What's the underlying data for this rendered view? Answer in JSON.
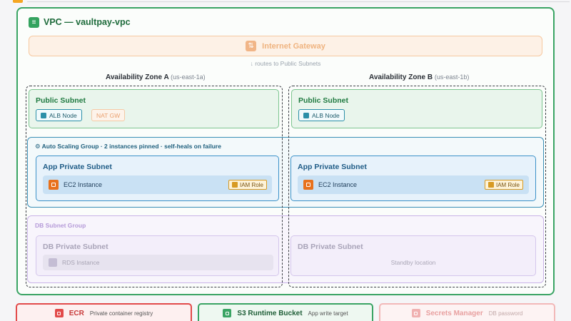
{
  "vpc": {
    "title": "VPC — vaultpay-vpc",
    "icon": "list-icon",
    "color": "#3aa464"
  },
  "gateway": {
    "label": "Internet Gateway",
    "icon": "transfer-icon",
    "note": "↓ routes to Public Subnets"
  },
  "zones": [
    {
      "name": "Availability Zone A",
      "region": "(us-east-1a)"
    },
    {
      "name": "Availability Zone B",
      "region": "(us-east-1b)"
    }
  ],
  "public_subnets": [
    {
      "title": "Public Subnet",
      "alb": "ALB Node",
      "nat": "NAT GW"
    },
    {
      "title": "Public Subnet",
      "alb": "ALB Node"
    }
  ],
  "asg": {
    "label": "⚙ Auto Scaling Group · 2 instances pinned · self-heals on failure"
  },
  "app_subnets": [
    {
      "title": "App Private Subnet",
      "instance": "EC2 Instance",
      "role": "IAM Role"
    },
    {
      "title": "App Private Subnet",
      "instance": "EC2 Instance",
      "role": "IAM Role"
    }
  ],
  "db_group": {
    "label": "DB Subnet Group"
  },
  "db_subnets": [
    {
      "title": "DB Private Subnet",
      "instance": "RDS Instance"
    },
    {
      "title": "DB Private Subnet",
      "standby": "Standby location"
    }
  ],
  "services": [
    {
      "name": "ECR",
      "desc": "Private container registry",
      "color": "#e24a4a"
    },
    {
      "name": "S3 Runtime Bucket",
      "desc": "App write target",
      "color": "#3aa464"
    },
    {
      "name": "Secrets Manager",
      "desc": "DB password",
      "color": "#f2b8b8"
    }
  ]
}
